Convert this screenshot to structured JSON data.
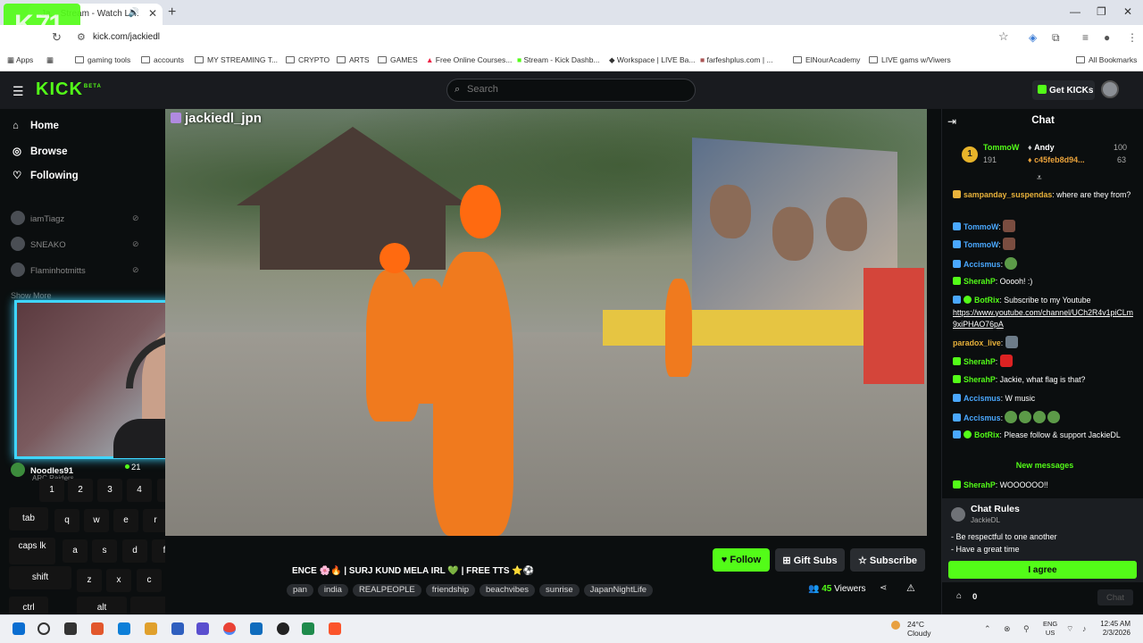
{
  "browser": {
    "tab_title": "Ja... Stream - Watch Li...",
    "url": "kick.com/jackiedl",
    "bookmarks": [
      "Apps",
      "gaming tools",
      "accounts",
      "MY STREAMING T...",
      "CRYPTO",
      "ARTS",
      "GAMES",
      "Free Online Courses...",
      "Stream - Kick Dashb...",
      "Workspace | LIVE Ba...",
      "farfeshplus.com | ...",
      "ElNourAcademy",
      "LIVE gams w/Viwers",
      "All Bookmarks"
    ],
    "overlay_logo": "K",
    "overlay_number": "71"
  },
  "header": {
    "logo": "KICK",
    "logo_badge": "BETA",
    "search_placeholder": "Search",
    "get_kicks": "Get KICKs"
  },
  "sidebar": {
    "nav": [
      "Home",
      "Browse",
      "Following"
    ],
    "channels": [
      "iamTiagz",
      "SNEAKO",
      "Flaminhotmitts"
    ],
    "show_more": "Show More",
    "noodles": {
      "name": "Noodles91",
      "category": "ARC Raiders",
      "viewers": "21"
    }
  },
  "keyboard": {
    "numbers": [
      "1",
      "2",
      "3",
      "4",
      "5"
    ],
    "row_q": [
      "tab",
      "q",
      "w",
      "e",
      "r",
      "t"
    ],
    "row_a": [
      "caps lk",
      "a",
      "s",
      "d",
      "f",
      "g"
    ],
    "row_z": [
      "shift",
      "z",
      "x",
      "c",
      "v"
    ],
    "row_ctrl": [
      "ctrl",
      "alt"
    ]
  },
  "stream": {
    "streamer_tag": "jackiedl_jpn",
    "title": "ENCE 🌸🔥 | SURJ KUND MELA IRL 💚 | FREE TTS ⭐⚽",
    "tags": [
      "pan",
      "india",
      "REALPEOPLE",
      "friendship",
      "beachvibes",
      "sunrise",
      "JapanNightLife"
    ],
    "follow": "Follow",
    "gift_subs": "Gift Subs",
    "subscribe": "Subscribe",
    "viewers_count": "45",
    "viewers_label": "Viewers"
  },
  "chat": {
    "title": "Chat",
    "leaderboard": [
      {
        "name": "TommoW",
        "value": "191"
      },
      {
        "name": "Andy",
        "value": "100"
      },
      {
        "name": "c45feb8d94...",
        "value": "63"
      }
    ],
    "messages": [
      {
        "user": "sampanday_suspendas",
        "color": "#e9b23b",
        "text": "where are they from?"
      },
      {
        "user": "TommoW",
        "color": "#4aa8ff",
        "text": ""
      },
      {
        "user": "TommoW",
        "color": "#4aa8ff",
        "text": ""
      },
      {
        "user": "Accismus",
        "color": "#4aa8ff",
        "text": ""
      },
      {
        "user": "SherahP",
        "color": "#53fc18",
        "text": "Ooooh! :)"
      },
      {
        "user": "BotRix",
        "color": "#53fc18",
        "text": "Subscribe to my Youtube",
        "link": "https://www.youtube.com/channel/UCh2R4v1piCLm9xiPHAO76pA"
      },
      {
        "user": "paradox_live",
        "color": "#e9b23b",
        "text": ""
      },
      {
        "user": "SherahP",
        "color": "#53fc18",
        "text": ""
      },
      {
        "user": "SherahP",
        "color": "#53fc18",
        "text": "Jackie, what flag is that?"
      },
      {
        "user": "Accismus",
        "color": "#4aa8ff",
        "text": "W music"
      },
      {
        "user": "Accismus",
        "color": "#4aa8ff",
        "text": ""
      },
      {
        "user": "BotRix",
        "color": "#53fc18",
        "text": "Please follow & support JackieDL"
      },
      {
        "user": "SherahP",
        "color": "#53fc18",
        "text": "WOOOOOO!!"
      }
    ],
    "new_messages": "New messages",
    "rules": {
      "title": "Chat Rules",
      "owner": "JackieDL",
      "items": [
        "- Be respectful to one another",
        "- Have a great time"
      ],
      "agree": "I agree"
    },
    "count": "0",
    "send": "Chat"
  },
  "taskbar": {
    "temp": "24°C",
    "weather": "Cloudy",
    "lang1": "ENG",
    "lang2": "US",
    "time": "12:45 AM",
    "date": "2/3/2026"
  }
}
